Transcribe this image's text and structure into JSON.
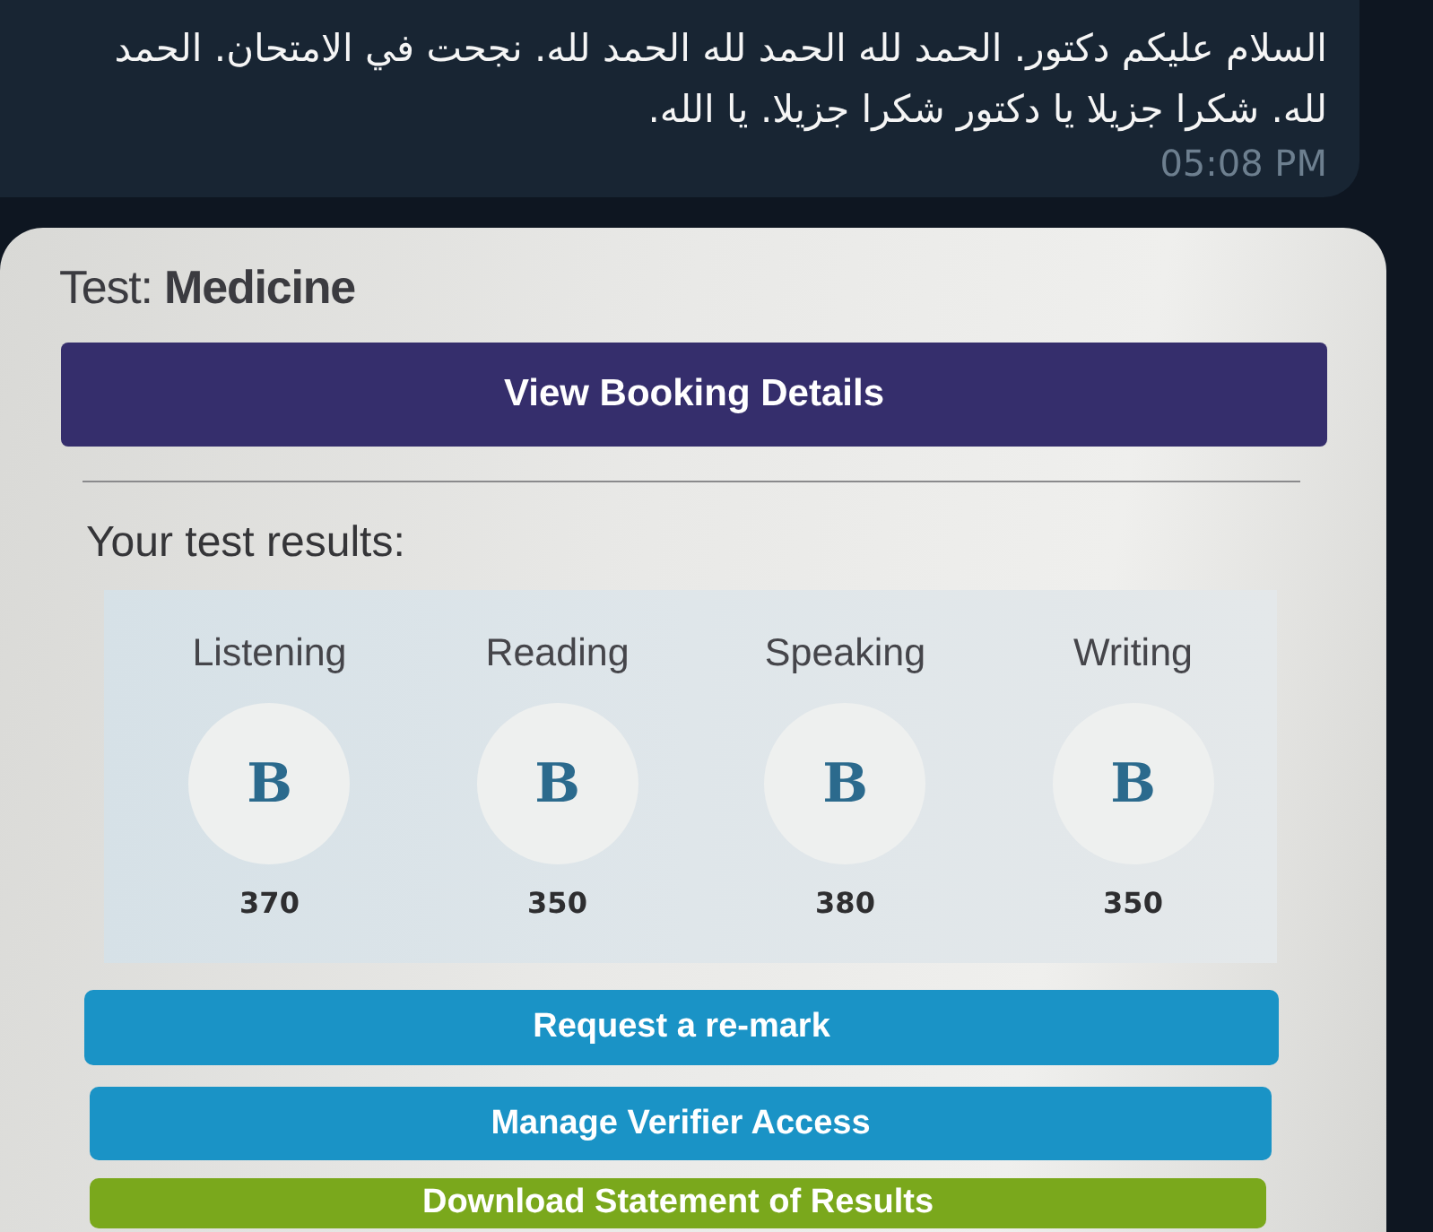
{
  "message": {
    "text": "السلام عليكم دكتور. الحمد لله الحمد لله الحمد لله. نجحت في الامتحان. الحمد لله. شكرا جزيلا يا دكتور شكرا جزيلا. يا الله.",
    "time": "05:08 PM"
  },
  "photo": {
    "test_title": "Test: **Medicine**",
    "primary_button": "View Booking Details",
    "results_heading": "Your test results:",
    "results": [
      {
        "skill": "Listening",
        "grade": "B",
        "score": "370"
      },
      {
        "skill": "Reading",
        "grade": "B",
        "score": "350"
      },
      {
        "skill": "Speaking",
        "grade": "B",
        "score": "380"
      },
      {
        "skill": "Writing",
        "grade": "B",
        "score": "350"
      }
    ],
    "buttons": [
      {
        "label": "Request a re-mark",
        "kind": "info"
      },
      {
        "label": "Manage Verifier Access",
        "kind": "info"
      },
      {
        "label": "Download Statement of Results",
        "kind": "download"
      }
    ]
  }
}
